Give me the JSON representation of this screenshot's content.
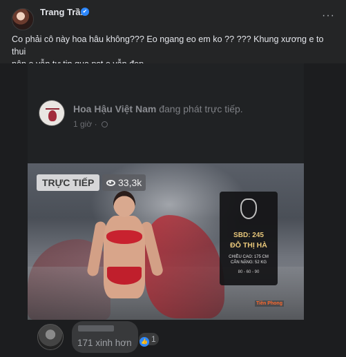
{
  "post": {
    "author": "Trang Trần",
    "caption_line1": "Co phải cô này hoa hâu không??? Eo ngang eo em ko ?? ??? Khung xương e to thui",
    "caption_line2": "nên e vẫn tự tin qua pst e vẫn đẹp.",
    "more_glyph": "···",
    "verified_glyph": "✔"
  },
  "embed": {
    "page_name": "Hoa Hậu Việt Nam",
    "page_status": "đang phát trực tiếp.",
    "time": "1 giờ",
    "dot": "·"
  },
  "video": {
    "live_label": "TRỰC TIẾP",
    "viewers": "33,3k",
    "card": {
      "sbd": "SBD: 245",
      "name": "ĐỖ THỊ HÀ",
      "height": "CHIỀU CAO: 175 CM",
      "weight": "CÂN NẶNG: 52 KG",
      "measurements": "80 - 60 - 90"
    },
    "brand": "Tiền Phong"
  },
  "comment": {
    "text": "171 xinh hơn",
    "like_count": "1",
    "like_glyph": "👍"
  },
  "colors": {
    "background": "#242526",
    "text": "#e4e6eb",
    "accent": "#2d88ff",
    "live_badge": "#d6d6d8",
    "card_gold": "#e8c77a"
  }
}
